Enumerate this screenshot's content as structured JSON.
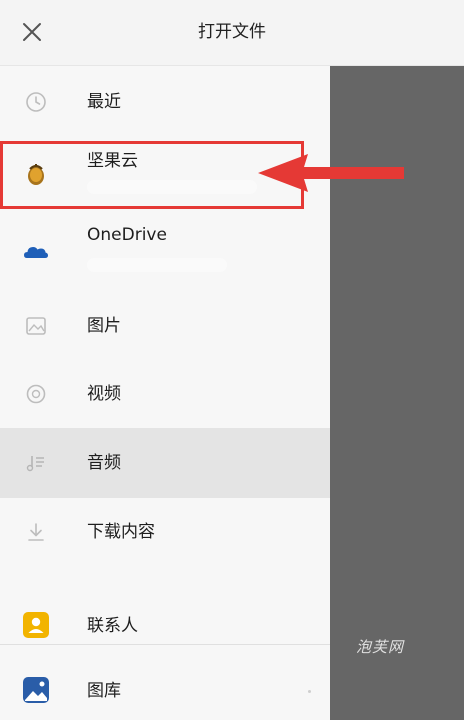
{
  "header": {
    "title": "打开文件",
    "close_icon": "close-icon"
  },
  "drawer": {
    "items": [
      {
        "label": "最近",
        "icon": "clock-icon"
      },
      {
        "label": "坚果云",
        "icon": "jianguoyun-icon",
        "subtitle_blurred": true
      },
      {
        "label": "OneDrive",
        "icon": "onedrive-cloud-icon",
        "subtitle_blurred": true
      },
      {
        "label": "图片",
        "icon": "image-icon"
      },
      {
        "label": "视频",
        "icon": "video-icon"
      },
      {
        "label": "音频",
        "icon": "music-icon",
        "selected": true
      },
      {
        "label": "下载内容",
        "icon": "download-icon"
      },
      {
        "label": "联系人",
        "icon": "contacts-icon"
      },
      {
        "label": "图库",
        "icon": "gallery-icon"
      }
    ]
  },
  "annotation": {
    "highlight_color": "#e53935"
  },
  "watermark": "泡芙网",
  "colors": {
    "overlay": "#666666",
    "selected_row": "#e4e4e4",
    "onedrive_blue": "#1f5fb8",
    "contacts_yellow": "#f2b400",
    "gallery_blue": "#2a5da8"
  }
}
